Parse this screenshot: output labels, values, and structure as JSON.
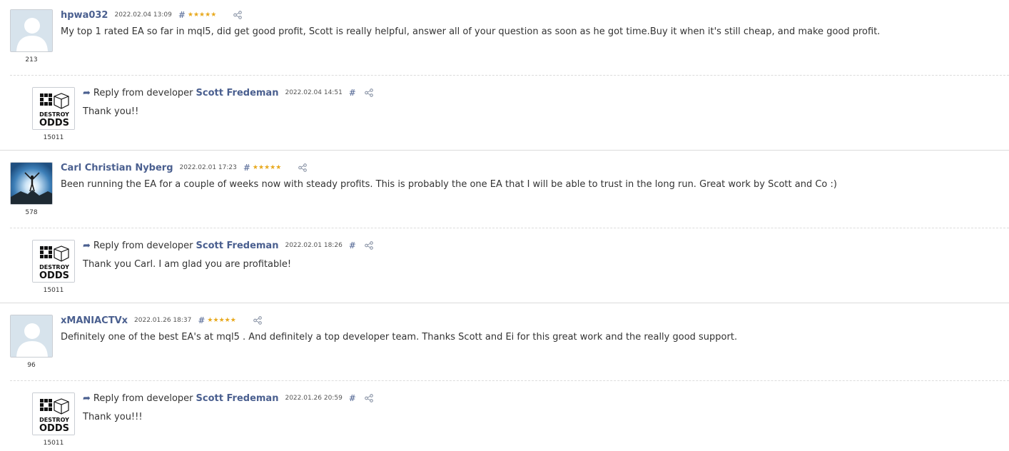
{
  "reviews": [
    {
      "author": "hpwa032",
      "avatar": "default-user-avatar",
      "rating_count": "213",
      "date": "2022.02.04 13:09",
      "hash": "#",
      "stars": 5,
      "text": "My top 1 rated EA so far in mql5, did get good profit, Scott is really helpful, answer all of your question as soon as he got time.Buy it when it's still cheap, and make good profit.",
      "reply": {
        "label": "Reply from developer",
        "developer": "Scott Fredeman",
        "date": "2022.02.04 14:51",
        "hash": "#",
        "text": "Thank you!!",
        "rating_count": "15011"
      }
    },
    {
      "author": "Carl Christian Nyberg",
      "avatar": "photo-person-sky-avatar",
      "rating_count": "578",
      "date": "2022.02.01 17:23",
      "hash": "#",
      "stars": 5,
      "text": "Been running the EA for a couple of weeks now with steady profits. This is probably the one EA that I will be able to trust in the long run. Great work by Scott and Co :)",
      "reply": {
        "label": "Reply from developer",
        "developer": "Scott Fredeman",
        "date": "2022.02.01 18:26",
        "hash": "#",
        "text": "Thank you Carl. I am glad you are profitable!",
        "rating_count": "15011"
      }
    },
    {
      "author": "xMANIACTVx",
      "avatar": "default-user-avatar",
      "rating_count": "96",
      "date": "2022.01.26 18:37",
      "hash": "#",
      "stars": 5,
      "text": "Definitely one of the best EA's at mql5 . And definitely a top developer team. Thanks Scott and Ei for this great work and the really good support.",
      "reply": {
        "label": "Reply from developer",
        "developer": "Scott Fredeman",
        "date": "2022.01.26 20:59",
        "hash": "#",
        "text": "Thank you!!!",
        "rating_count": "15011"
      }
    }
  ],
  "developer_logo_text": [
    "DESTROY",
    "ODDS"
  ],
  "colors": {
    "author": "#4a5f8f",
    "stars": "#e8a91e",
    "text": "#333333",
    "separator": "#dcdcdc"
  },
  "icons": {
    "share": "share-icon",
    "reply": "reply-arrow-icon",
    "star": "star-icon"
  }
}
